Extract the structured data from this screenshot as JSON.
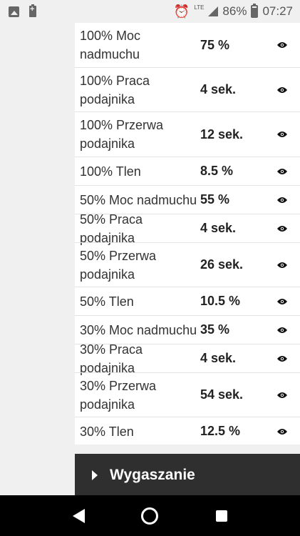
{
  "status_bar": {
    "network": "LTE",
    "battery_percent": "86%",
    "time": "07:27",
    "battery_level": 0.86,
    "icons": [
      "image-icon",
      "battery-saver-icon",
      "alarm-icon",
      "signal-icon",
      "battery-icon"
    ]
  },
  "rows": [
    {
      "label": "100% Moc nadmuchu",
      "value": "75 %"
    },
    {
      "label": "100% Praca podajnika",
      "value": "4 sek."
    },
    {
      "label": "100% Przerwa podajnika",
      "value": "12 sek."
    },
    {
      "label": "100% Tlen",
      "value": "8.5 %"
    },
    {
      "label": "50% Moc nadmuchu",
      "value": "55 %"
    },
    {
      "label": "50% Praca podajnika",
      "value": "4 sek."
    },
    {
      "label": "50% Przerwa podajnika",
      "value": "26 sek."
    },
    {
      "label": "50% Tlen",
      "value": "10.5 %"
    },
    {
      "label": "30% Moc nadmuchu",
      "value": "35 %"
    },
    {
      "label": "30% Praca podajnika",
      "value": "4 sek."
    },
    {
      "label": "30% Przerwa podajnika",
      "value": "54 sek."
    },
    {
      "label": "30% Tlen",
      "value": "12.5 %"
    }
  ],
  "section": {
    "title": "Wygaszanie",
    "icon": "chevron-right-icon"
  },
  "nav": {
    "icons": [
      "back-icon",
      "home-icon",
      "recents-icon"
    ]
  },
  "colors": {
    "section_bg": "#2f2f2f",
    "card_bg": "#ffffff",
    "page_bg": "#f0f0f0"
  }
}
